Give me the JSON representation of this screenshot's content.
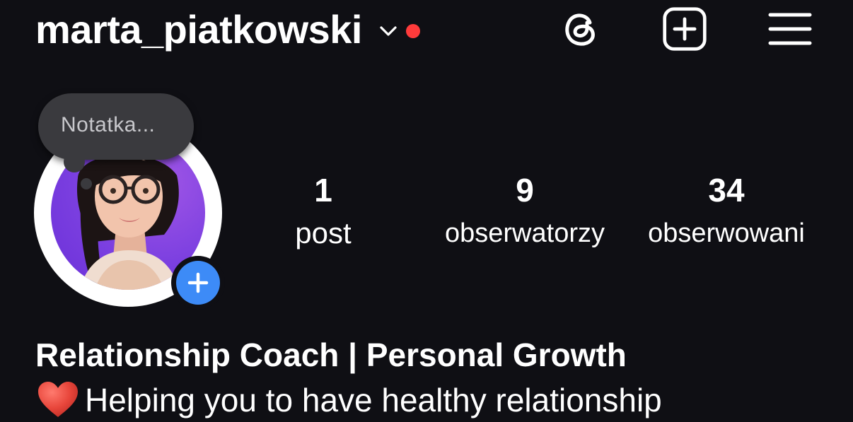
{
  "header": {
    "username": "marta_piatkowski",
    "account_switcher_icon": "chevron-down-icon",
    "notification_dot_color": "#ff3b3b",
    "actions": [
      {
        "icon": "threads-icon"
      },
      {
        "icon": "create-post-icon"
      },
      {
        "icon": "menu-icon"
      }
    ]
  },
  "note": {
    "placeholder": "Notatka..."
  },
  "profile": {
    "avatar_icon": "profile-photo",
    "add_story_icon": "plus-icon",
    "add_story_color": "#3d8bf7"
  },
  "stats": {
    "posts": {
      "value": "1",
      "label": "post"
    },
    "followers": {
      "value": "9",
      "label": "obserwatorzy"
    },
    "following": {
      "value": "34",
      "label": "obserwowani"
    }
  },
  "bio": {
    "name": "Relationship Coach | Personal Growth",
    "line1_emoji": "heart-emoji",
    "line1_text": "Helping you to have healthy relationship"
  }
}
